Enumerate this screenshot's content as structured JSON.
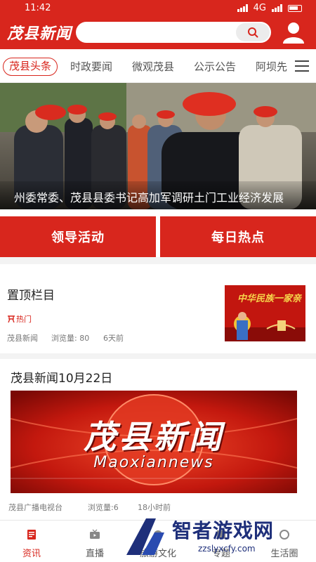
{
  "status_bar": {
    "time": "11:42",
    "network": "4G"
  },
  "header": {
    "logo_text": "茂县新闻",
    "search_placeholder": "",
    "colors": {
      "brand": "#d8261d"
    },
    "icons": {
      "search": "search-icon",
      "user": "user-icon"
    }
  },
  "tabs": [
    {
      "label": "茂县头条",
      "active": true
    },
    {
      "label": "时政要闻",
      "active": false
    },
    {
      "label": "微观茂县",
      "active": false
    },
    {
      "label": "公示公告",
      "active": false
    },
    {
      "label": "阿坝先",
      "active": false
    }
  ],
  "hero": {
    "caption": "州委常委、茂县县委书记高加军调研土门工业经济发展"
  },
  "actions": {
    "left": "领导活动",
    "right": "每日热点"
  },
  "articles": [
    {
      "title": "置顶栏目",
      "badge": "热门",
      "source": "茂县新闻",
      "views_label": "浏览量",
      "views": "80",
      "time": "6天前",
      "thumb_text": "中华民族一家亲"
    },
    {
      "title": "茂县新闻10月22日",
      "banner_title": "茂县新闻",
      "banner_subtitle": "Maoxiannews",
      "source": "茂县广播电视台",
      "views_label": "浏览量",
      "views": "6",
      "time": "18小时前"
    }
  ],
  "bottom_nav": [
    {
      "label": "资讯",
      "icon": "news-icon",
      "active": true
    },
    {
      "label": "直播",
      "icon": "tv-icon",
      "active": false
    },
    {
      "label": "旅游文化",
      "icon": "travel-icon",
      "active": false
    },
    {
      "label": "专题",
      "icon": "topic-icon",
      "active": false
    },
    {
      "label": "生活圈",
      "icon": "life-icon",
      "active": false
    }
  ],
  "watermark": {
    "text": "智者游戏网",
    "url": "zzslyxcfy.com"
  }
}
